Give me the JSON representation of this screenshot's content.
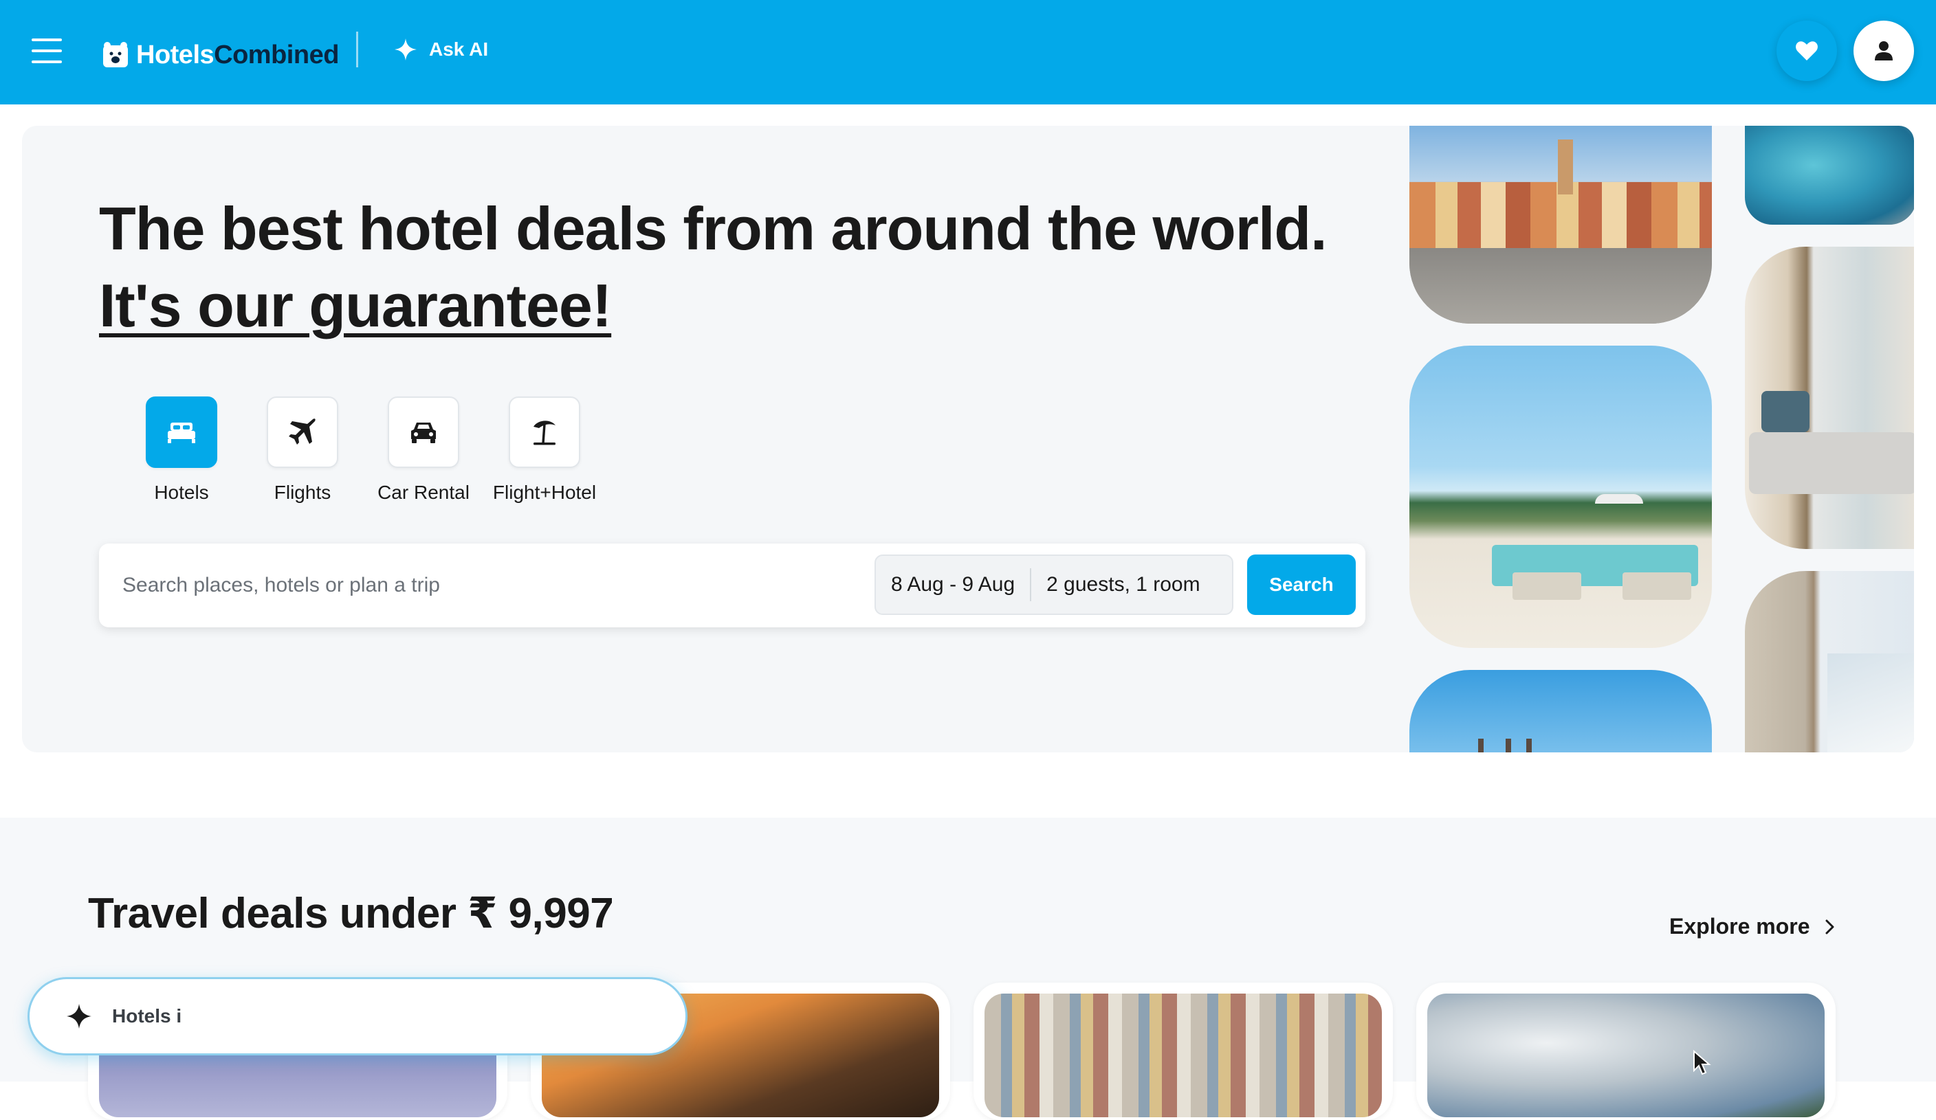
{
  "header": {
    "logo": {
      "part1": "Hotels",
      "part2": "Combined"
    },
    "ask_ai_label": "Ask AI",
    "icons": {
      "menu": "hamburger-menu-icon",
      "ask_ai": "sparkle-icon",
      "favorites": "heart-icon",
      "account": "user-icon"
    },
    "colors": {
      "brand": "#03a9e9"
    }
  },
  "hero": {
    "title_main": "The best hotel deals from around the world.",
    "title_link": "It's our guarantee!",
    "verticals": [
      {
        "label": "Hotels",
        "icon": "bed-icon",
        "active": true
      },
      {
        "label": "Flights",
        "icon": "plane-icon",
        "active": false
      },
      {
        "label": "Car Rental",
        "icon": "car-icon",
        "active": false
      },
      {
        "label": "Flight+Hotel",
        "icon": "beach-umbrella-icon",
        "active": false
      }
    ],
    "search": {
      "placeholder": "Search places, hotels or plan a trip",
      "dates": "8 Aug - 9 Aug",
      "guests": "2 guests, 1 room",
      "button": "Search"
    }
  },
  "deals": {
    "title": "Travel deals under ₹ 9,997",
    "explore_more": "Explore more"
  },
  "ai_chat": {
    "text": "Hotels i",
    "icon": "sparkle-icon"
  }
}
